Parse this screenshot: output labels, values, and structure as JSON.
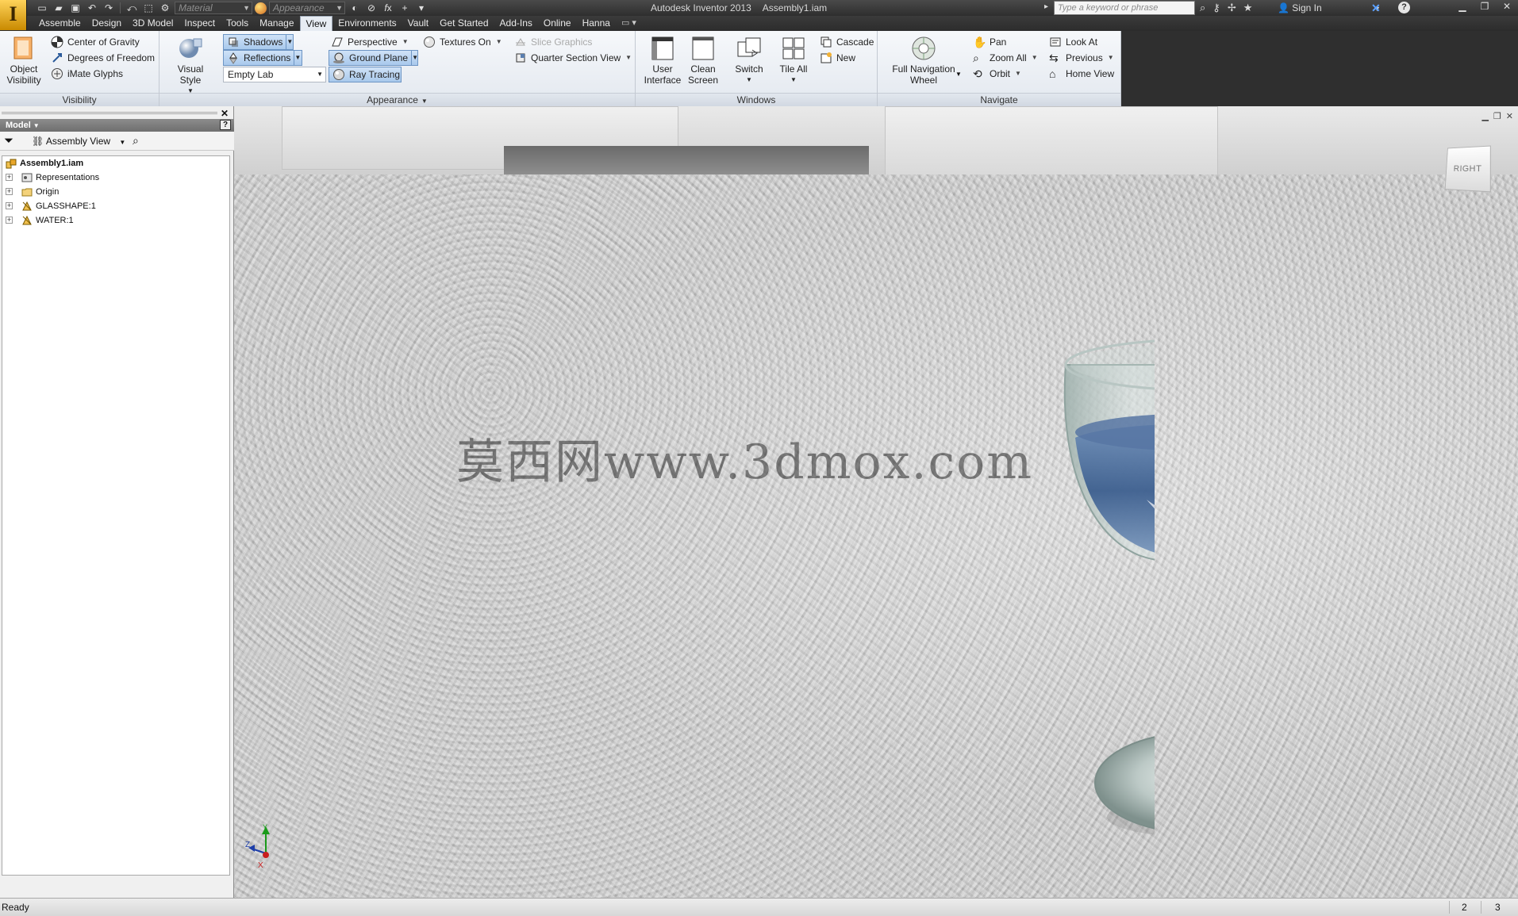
{
  "titlebar": {
    "app_letter": "I",
    "app_name": "Autodesk Inventor 2013",
    "document": "Assembly1.iam",
    "material_placeholder": "Material",
    "appearance_placeholder": "Appearance",
    "search_placeholder": "Type a keyword or phrase",
    "sign_in": "Sign In"
  },
  "tabs": [
    "Assemble",
    "Design",
    "3D Model",
    "Inspect",
    "Tools",
    "Manage",
    "View",
    "Environments",
    "Vault",
    "Get Started",
    "Add-Ins",
    "Online",
    "Hanna"
  ],
  "active_tab": "View",
  "ribbon": {
    "visibility": {
      "title": "Visibility",
      "object_visibility": "Object Visibility",
      "center_of_gravity": "Center of Gravity",
      "degrees_of_freedom": "Degrees of Freedom",
      "imate_glyphs": "iMate Glyphs"
    },
    "appearance": {
      "title": "Appearance",
      "visual_style": "Visual Style",
      "shadows": "Shadows",
      "reflections": "Reflections",
      "lighting_style": "Empty Lab",
      "perspective": "Perspective",
      "ground_plane": "Ground Plane",
      "ray_tracing": "Ray Tracing",
      "textures_on": "Textures On",
      "slice_graphics": "Slice Graphics",
      "quarter_section_view": "Quarter Section View"
    },
    "windows": {
      "title": "Windows",
      "user_interface_1": "User",
      "user_interface_2": "Interface",
      "clean_screen_1": "Clean",
      "clean_screen_2": "Screen",
      "switch": "Switch",
      "tile_all": "Tile All",
      "cascade": "Cascade",
      "new": "New"
    },
    "navigate": {
      "title": "Navigate",
      "full_nav_wheel_1": "Full Navigation",
      "full_nav_wheel_2": "Wheel",
      "pan": "Pan",
      "zoom_all": "Zoom All",
      "orbit": "Orbit",
      "look_at": "Look At",
      "previous": "Previous",
      "home_view": "Home View"
    }
  },
  "browser": {
    "header": "Model",
    "view_mode": "Assembly View",
    "tree": [
      {
        "label": "Assembly1.iam",
        "root": true
      },
      {
        "label": "Representations"
      },
      {
        "label": "Origin"
      },
      {
        "label": "GLASSHAPE:1"
      },
      {
        "label": "WATER:1"
      }
    ]
  },
  "viewport": {
    "viewcube_face": "RIGHT",
    "watermark": "莫西网www.3dmox.com",
    "axis_labels": {
      "x": "X",
      "y": "Y",
      "z": "Z"
    }
  },
  "status": {
    "text": "Ready",
    "count_1": "2",
    "count_2": "3"
  },
  "colors": {
    "ribbon_bg": "#e7ecf3",
    "toggle_on": "#a9c9ec",
    "title_bg": "#2e2e2e",
    "water": "#3d5f8f"
  }
}
